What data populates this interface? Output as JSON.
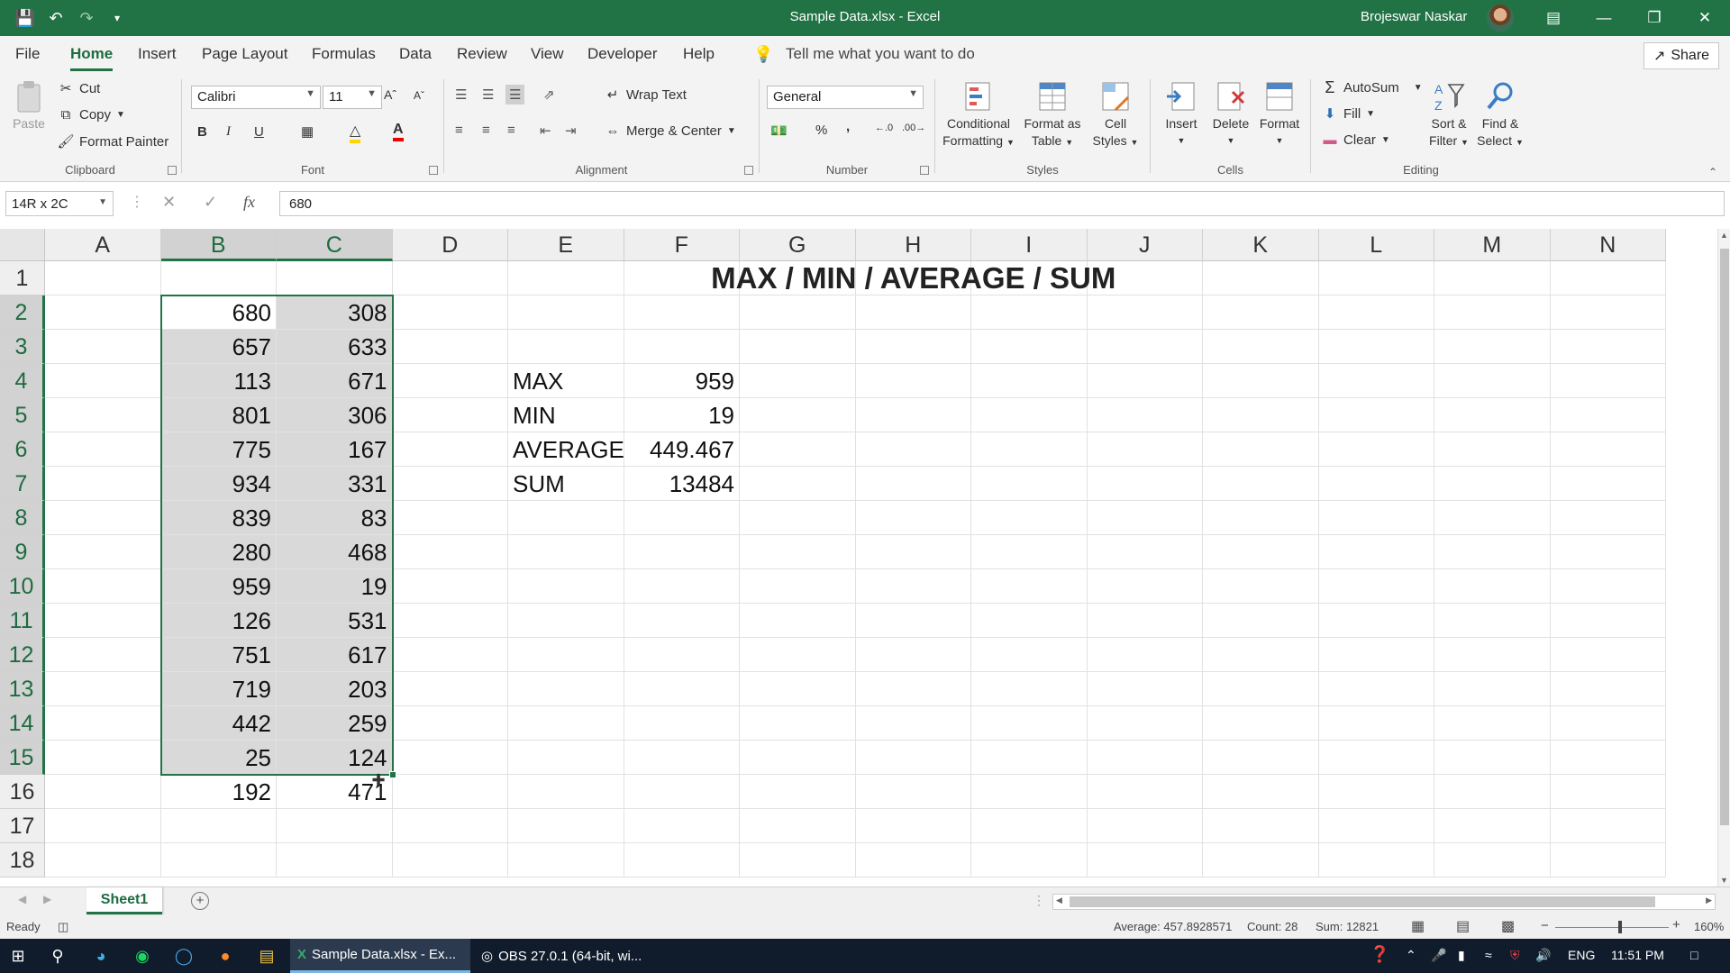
{
  "window": {
    "title": "Sample Data.xlsx  -  Excel",
    "user": "Brojeswar Naskar",
    "minimize_icon": "minimize-icon",
    "restore_icon": "restore-icon",
    "close_icon": "close-icon"
  },
  "menu": {
    "tabs": [
      "File",
      "Home",
      "Insert",
      "Page Layout",
      "Formulas",
      "Data",
      "Review",
      "View",
      "Developer",
      "Help"
    ],
    "active_tab": "Home",
    "tell_me": "Tell me what you want to do",
    "share": "Share"
  },
  "ribbon": {
    "clipboard": {
      "label": "Clipboard",
      "paste": "Paste",
      "cut": "Cut",
      "copy": "Copy",
      "format_painter": "Format Painter"
    },
    "font": {
      "label": "Font",
      "font_name": "Calibri",
      "font_size": "11",
      "bold": "B",
      "italic": "I",
      "underline": "U"
    },
    "alignment": {
      "label": "Alignment",
      "wrap_text": "Wrap Text",
      "merge_center": "Merge & Center"
    },
    "number": {
      "label": "Number",
      "format": "General",
      "percent": "%",
      "comma": ","
    },
    "styles": {
      "label": "Styles",
      "conditional_1": "Conditional",
      "conditional_2": "Formatting",
      "format_table_1": "Format as",
      "format_table_2": "Table",
      "cell_styles_1": "Cell",
      "cell_styles_2": "Styles"
    },
    "cells": {
      "label": "Cells",
      "insert": "Insert",
      "delete": "Delete",
      "format": "Format"
    },
    "editing": {
      "label": "Editing",
      "autosum": "AutoSum",
      "fill": "Fill",
      "clear": "Clear",
      "sort_1": "Sort &",
      "sort_2": "Filter",
      "find_1": "Find &",
      "find_2": "Select"
    }
  },
  "formula_bar": {
    "name_box": "14R x 2C",
    "fx": "fx",
    "value": "680"
  },
  "columns": [
    "A",
    "B",
    "C",
    "D",
    "E",
    "F",
    "G",
    "H",
    "I",
    "J",
    "K",
    "L",
    "M",
    "N"
  ],
  "rows": [
    "1",
    "2",
    "3",
    "4",
    "5",
    "6",
    "7",
    "8",
    "9",
    "10",
    "11",
    "12",
    "13",
    "14",
    "15",
    "16",
    "17",
    "18"
  ],
  "sheet": {
    "title": "MAX / MIN / AVERAGE / SUM",
    "col_b": [
      "680",
      "657",
      "113",
      "801",
      "775",
      "934",
      "839",
      "280",
      "959",
      "126",
      "751",
      "719",
      "442",
      "25",
      "192"
    ],
    "col_c": [
      "308",
      "633",
      "671",
      "306",
      "167",
      "331",
      "83",
      "468",
      "19",
      "531",
      "617",
      "203",
      "259",
      "124",
      "471"
    ],
    "stats": [
      {
        "label": "MAX",
        "value": "959"
      },
      {
        "label": "MIN",
        "value": "19"
      },
      {
        "label": "AVERAGE",
        "value": "449.467"
      },
      {
        "label": "SUM",
        "value": "13484"
      }
    ]
  },
  "sheet_tabs": [
    "Sheet1"
  ],
  "status": {
    "ready": "Ready",
    "average": "Average: 457.8928571",
    "count": "Count: 28",
    "sum": "Sum: 12821",
    "zoom": "160%"
  },
  "taskbar": {
    "excel_app": "Sample Data.xlsx - Ex...",
    "obs_app": "OBS 27.0.1 (64-bit, wi...",
    "lang": "ENG",
    "time": "11:51 PM"
  }
}
